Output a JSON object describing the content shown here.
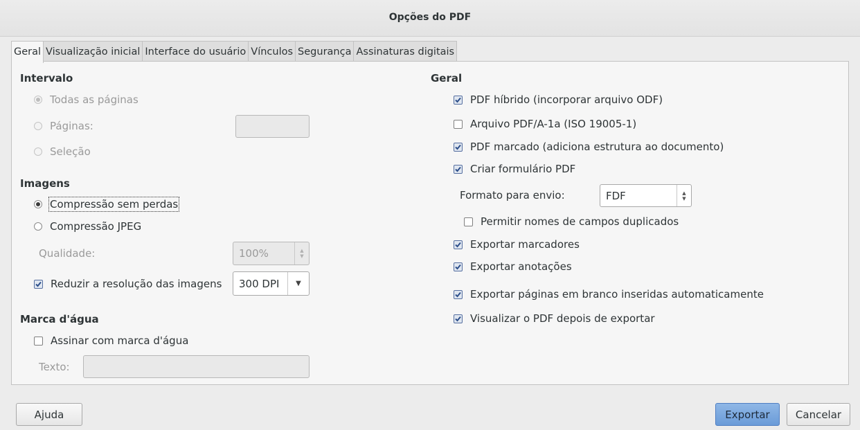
{
  "window": {
    "title": "Opções do PDF"
  },
  "tabs": [
    {
      "label": "Geral",
      "active": true
    },
    {
      "label": "Visualização inicial"
    },
    {
      "label": "Interface do usuário"
    },
    {
      "label": "Vínculos"
    },
    {
      "label": "Segurança"
    },
    {
      "label": "Assinaturas digitais"
    }
  ],
  "range": {
    "heading": "Intervalo",
    "all_pages": {
      "label": "Todas as páginas",
      "checked": true,
      "enabled": false
    },
    "pages": {
      "label": "Páginas:",
      "checked": false,
      "enabled": false,
      "value": ""
    },
    "selection": {
      "label": "Seleção",
      "checked": false,
      "enabled": false
    }
  },
  "images": {
    "heading": "Imagens",
    "lossless": {
      "label": "Compressão sem perdas",
      "checked": true
    },
    "jpeg": {
      "label": "Compressão JPEG",
      "checked": false
    },
    "quality": {
      "label": "Qualidade:",
      "value": "100%",
      "enabled": false
    },
    "reduce": {
      "label": "Reduzir a resolução das imagens",
      "checked": true
    },
    "dpi": {
      "value": "300 DPI"
    }
  },
  "watermark": {
    "heading": "Marca d'água",
    "sign": {
      "label": "Assinar com marca d'água",
      "checked": false
    },
    "text": {
      "label": "Texto:",
      "value": "",
      "enabled": false
    }
  },
  "general": {
    "heading": "Geral",
    "hybrid": {
      "label": "PDF híbrido (incorporar arquivo ODF)",
      "checked": true
    },
    "pdfa": {
      "label": "Arquivo PDF/A-1a (ISO 19005-1)",
      "checked": false
    },
    "tagged": {
      "label": "PDF marcado (adiciona estrutura ao documento)",
      "checked": true
    },
    "form": {
      "label": "Criar formulário PDF",
      "checked": true
    },
    "submit_format": {
      "label": "Formato para envio:",
      "value": "FDF"
    },
    "duplicate_names": {
      "label": "Permitir nomes de campos duplicados",
      "checked": false
    },
    "bookmarks": {
      "label": "Exportar marcadores",
      "checked": true
    },
    "comments": {
      "label": "Exportar anotações",
      "checked": true
    },
    "blank_pages": {
      "label": "Exportar páginas em branco inseridas automaticamente",
      "checked": true
    },
    "view_after": {
      "label": "Visualizar o PDF depois de exportar",
      "checked": true
    }
  },
  "buttons": {
    "help": "Ajuda",
    "export": "Exportar",
    "cancel": "Cancelar"
  }
}
